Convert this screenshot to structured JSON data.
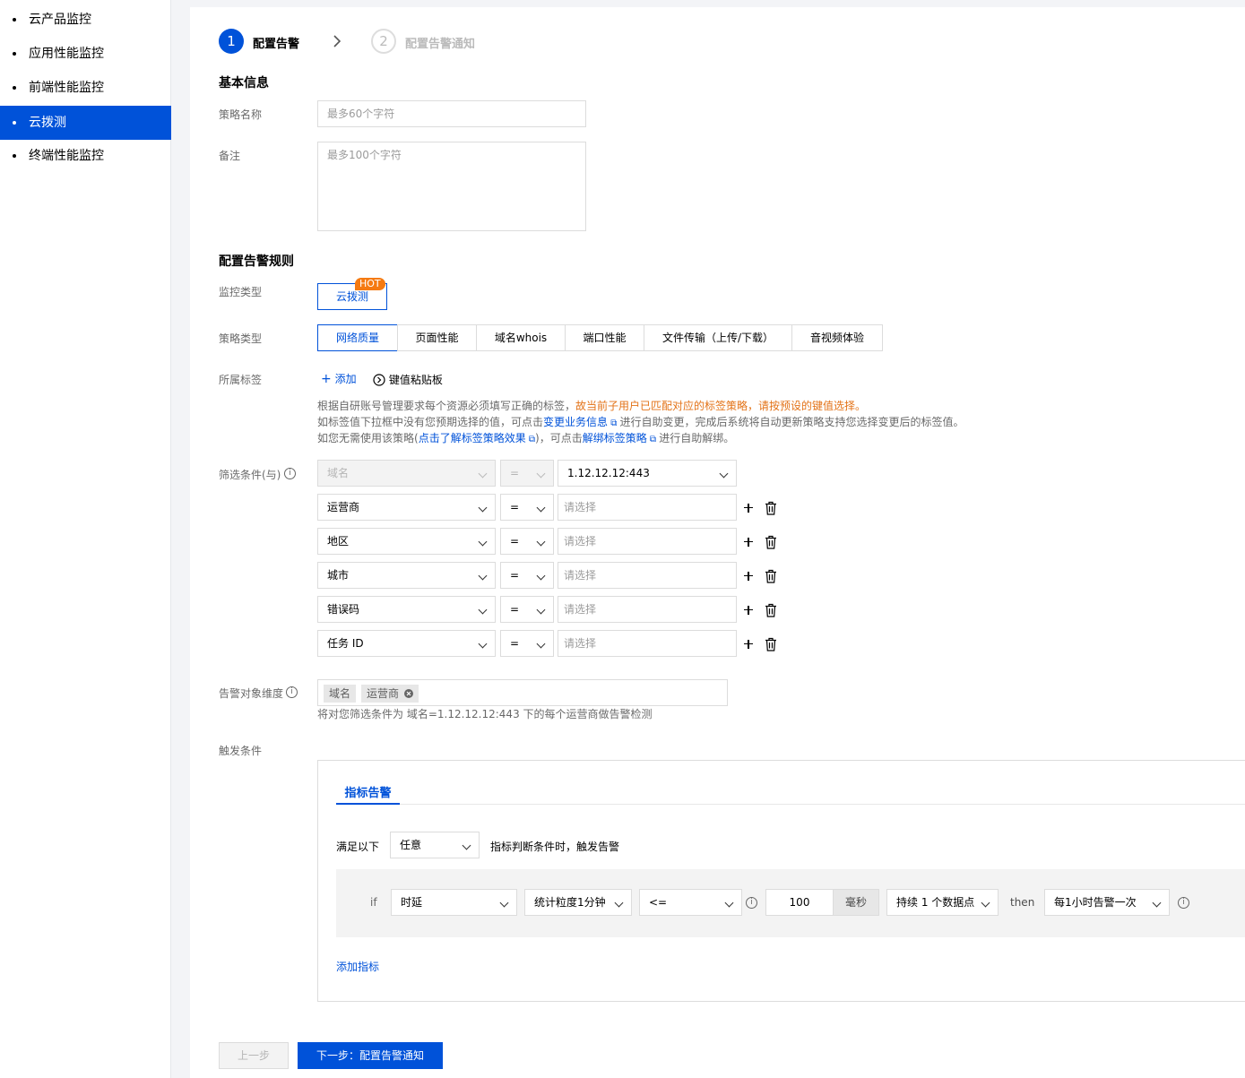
{
  "sidebar": {
    "items": [
      {
        "label": "云产品监控"
      },
      {
        "label": "应用性能监控"
      },
      {
        "label": "前端性能监控"
      },
      {
        "label": "云拨测"
      },
      {
        "label": "终端性能监控"
      }
    ]
  },
  "steps": {
    "step1_num": "1",
    "step1_label": "配置告警",
    "step2_num": "2",
    "step2_label": "配置告警通知"
  },
  "basic": {
    "title": "基本信息",
    "name_label": "策略名称",
    "name_placeholder": "最多60个字符",
    "remark_label": "备注",
    "remark_placeholder": "最多100个字符"
  },
  "rules": {
    "title": "配置告警规则",
    "monitor_type_label": "监控类型",
    "monitor_type": "云拨测",
    "hot": "HOT",
    "policy_type_label": "策略类型",
    "policy_types": [
      "网络质量",
      "页面性能",
      "域名whois",
      "端口性能",
      "文件传输（上传/下载）",
      "音视频体验"
    ],
    "tag_label": "所属标签",
    "tag_add": "添加",
    "tag_paste": "键值粘贴板"
  },
  "tag_notes": {
    "line1_a": "根据自研账号管理要求每个资源必须填写正确的标签，",
    "line1_b": "故当前子用户已匹配对应的标签策略，请按预设的键值选择。",
    "line2_a": "如标签值下拉框中没有您预期选择的值，可点击",
    "line2_link": "变更业务信息",
    "line2_b": "进行自助变更，完成后系统将自动更新策略支持您选择变更后的标签值。",
    "line3_a": "如您无需使用该策略(",
    "line3_link1": "点击了解标签策略效果",
    "line3_b": ")，可点击",
    "line3_link2": "解绑标签策略",
    "line3_c": "进行自助解绑。"
  },
  "filter": {
    "label": "筛选条件(与)",
    "first": {
      "key": "域名",
      "op": "=",
      "value": "1.12.12.12:443"
    },
    "rows": [
      {
        "key": "运营商",
        "op": "=",
        "placeholder": "请选择"
      },
      {
        "key": "地区",
        "op": "=",
        "placeholder": "请选择"
      },
      {
        "key": "城市",
        "op": "=",
        "placeholder": "请选择"
      },
      {
        "key": "错误码",
        "op": "=",
        "placeholder": "请选择"
      },
      {
        "key": "任务 ID",
        "op": "=",
        "placeholder": "请选择"
      }
    ]
  },
  "dimension": {
    "label": "告警对象维度",
    "chips": [
      "域名",
      "运营商"
    ],
    "hint": "将对您筛选条件为 域名=1.12.12.12:443 下的每个运营商做告警检测"
  },
  "trigger": {
    "label": "触发条件",
    "tab": "指标告警",
    "satisfy": "满足以下",
    "any": "任意",
    "suffix": "指标判断条件时，触发告警",
    "cond": {
      "if": "if",
      "metric": "时延",
      "period": "统计粒度1分钟",
      "op": "<=",
      "value": "100",
      "unit": "毫秒",
      "duration": "持续 1 个数据点",
      "then": "then",
      "freq": "每1小时告警一次"
    },
    "add_metric": "添加指标"
  },
  "footer": {
    "prev": "上一步",
    "next": "下一步：配置告警通知"
  }
}
